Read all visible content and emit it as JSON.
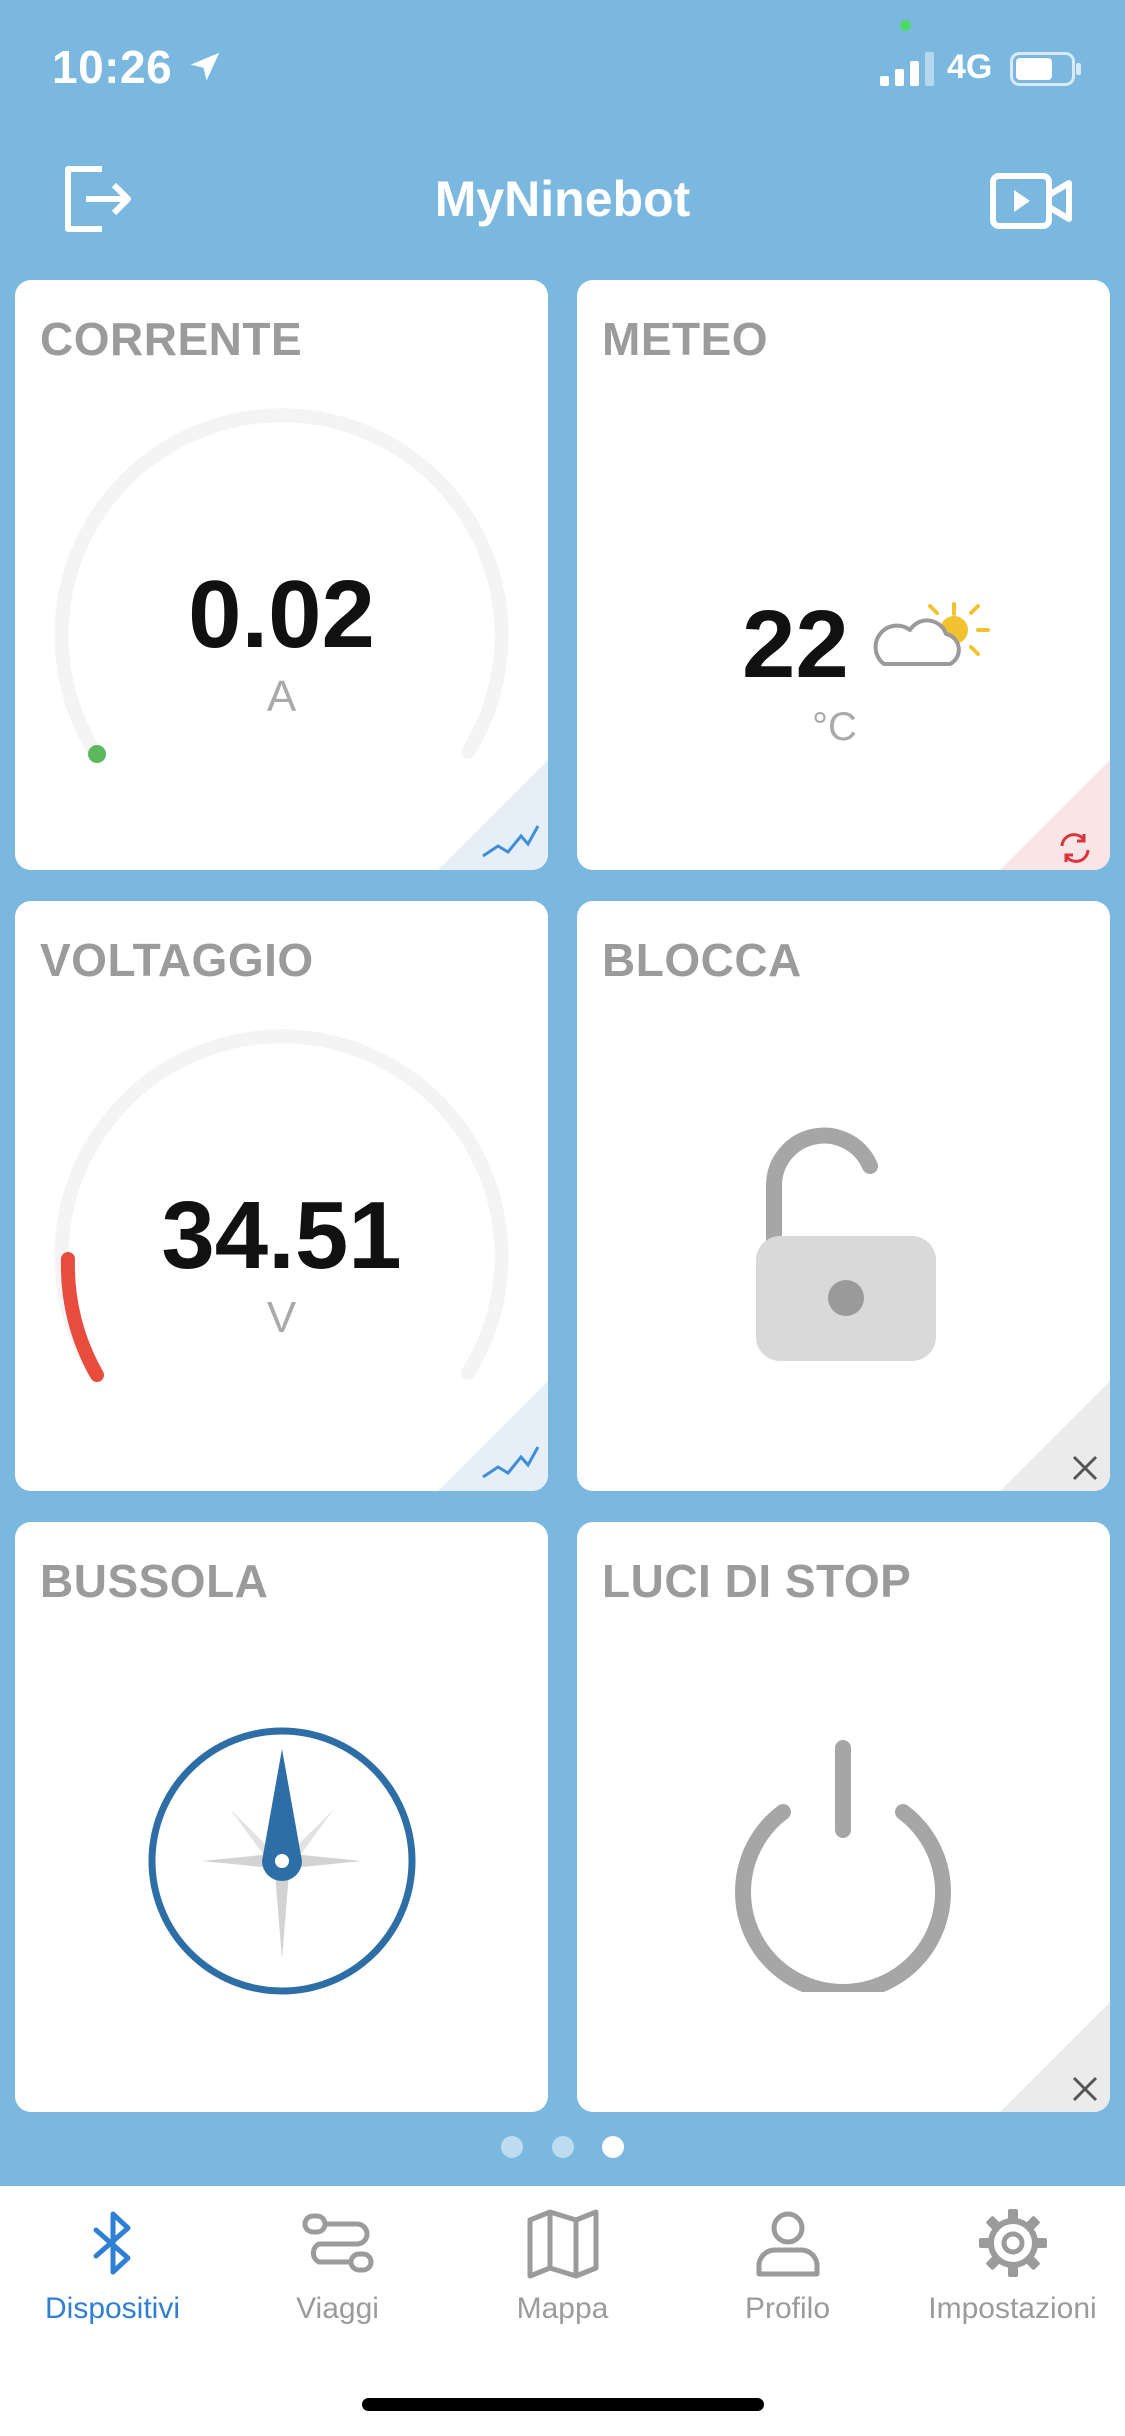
{
  "status": {
    "time": "10:26",
    "network": "4G"
  },
  "header": {
    "title": "MyNinebot"
  },
  "cards": {
    "current": {
      "title": "CORRENTE",
      "value": "0.02",
      "unit": "A"
    },
    "weather": {
      "title": "METEO",
      "temperature": "22",
      "unit": "°C"
    },
    "voltage": {
      "title": "VOLTAGGIO",
      "value": "34.51",
      "unit": "V"
    },
    "lock": {
      "title": "BLOCCA"
    },
    "compass": {
      "title": "BUSSOLA"
    },
    "brake_lights": {
      "title": "LUCI DI STOP"
    }
  },
  "pager": {
    "count": 3,
    "active": 3
  },
  "tabs": [
    {
      "label": "Dispositivi",
      "icon": "bluetooth-icon"
    },
    {
      "label": "Viaggi",
      "icon": "route-icon"
    },
    {
      "label": "Mappa",
      "icon": "map-icon"
    },
    {
      "label": "Profilo",
      "icon": "profile-icon"
    },
    {
      "label": "Impostazioni",
      "icon": "gear-icon"
    }
  ],
  "colors": {
    "background": "#7ab8e0",
    "accent": "#2f7fd4",
    "gauge_current": "#5cb85c",
    "gauge_voltage": "#e74c3c",
    "compass": "#2e6ea6"
  }
}
